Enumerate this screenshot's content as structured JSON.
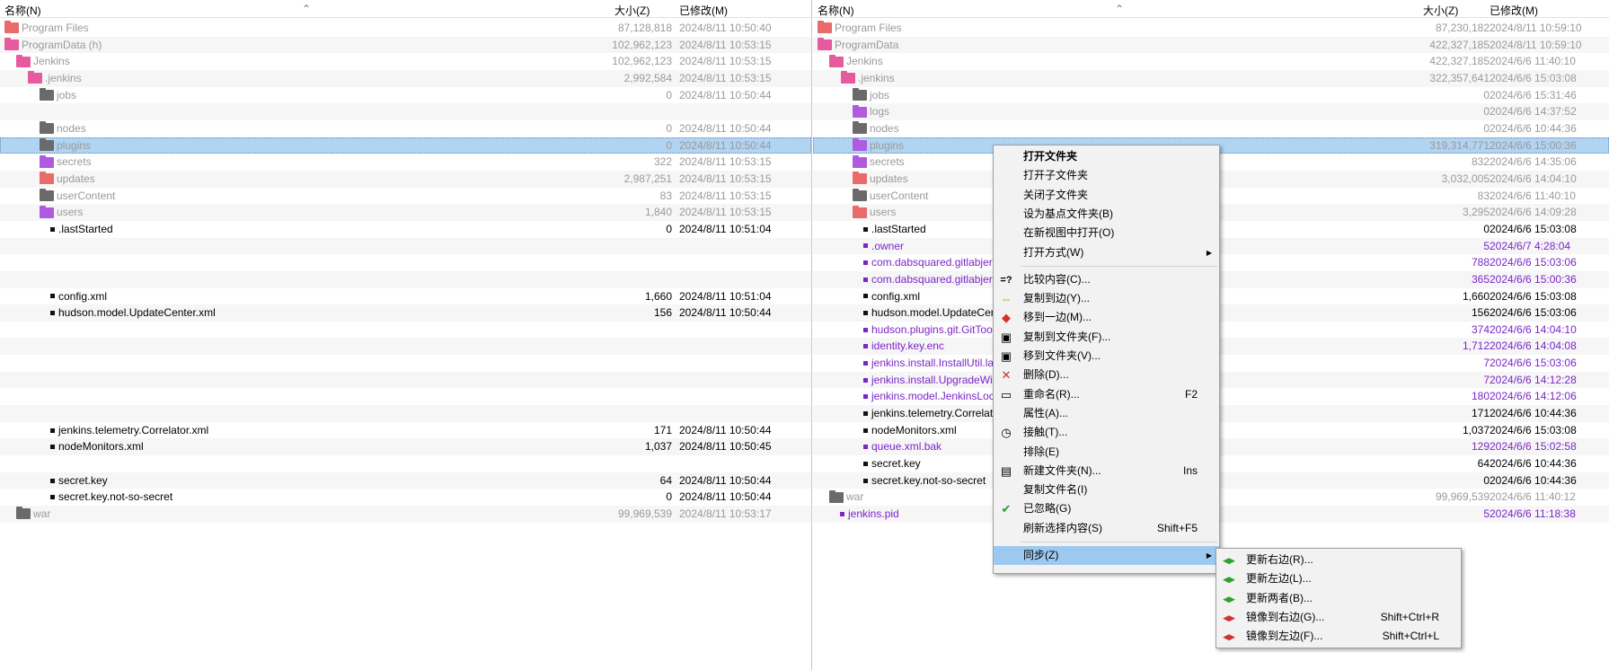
{
  "columns": {
    "name": "名称(N)",
    "size": "大小(Z)",
    "modified": "已修改(M)"
  },
  "left": {
    "rows": [
      {
        "name": "Program Files",
        "size": "87,128,818",
        "date": "2024/8/11 10:50:40",
        "type": "folder",
        "icon": "folder-red-icon",
        "tone": "gray"
      },
      {
        "name": "ProgramData (h)",
        "size": "102,962,123",
        "date": "2024/8/11 10:53:15",
        "type": "folder",
        "icon": "folder-pink-icon",
        "tone": "gray"
      },
      {
        "name": "Jenkins",
        "size": "102,962,123",
        "date": "2024/8/11 10:53:15",
        "type": "folder",
        "icon": "folder-pink-icon",
        "tone": "gray"
      },
      {
        "name": ".jenkins",
        "size": "2,992,584",
        "date": "2024/8/11 10:53:15",
        "type": "folder",
        "icon": "folder-pink-icon",
        "tone": "gray"
      },
      {
        "name": "jobs",
        "size": "0",
        "date": "2024/8/11 10:50:44",
        "type": "folder",
        "icon": "folder-dark-icon",
        "tone": "gray"
      },
      {
        "name": "",
        "size": "",
        "date": "",
        "type": "blank"
      },
      {
        "name": "nodes",
        "size": "0",
        "date": "2024/8/11 10:50:44",
        "type": "folder",
        "icon": "folder-dark-icon",
        "tone": "gray"
      },
      {
        "name": "plugins",
        "size": "0",
        "date": "2024/8/11 10:50:44",
        "type": "folder",
        "icon": "folder-dark-icon",
        "tone": "gray",
        "selected": true
      },
      {
        "name": "secrets",
        "size": "322",
        "date": "2024/8/11 10:53:15",
        "type": "folder",
        "icon": "folder-purple-icon",
        "tone": "gray"
      },
      {
        "name": "updates",
        "size": "2,987,251",
        "date": "2024/8/11 10:53:15",
        "type": "folder",
        "icon": "folder-red-icon",
        "tone": "gray"
      },
      {
        "name": "userContent",
        "size": "83",
        "date": "2024/8/11 10:53:15",
        "type": "folder",
        "icon": "folder-dark-icon",
        "tone": "gray"
      },
      {
        "name": "users",
        "size": "1,840",
        "date": "2024/8/11 10:53:15",
        "type": "folder",
        "icon": "folder-purple-icon",
        "tone": "gray"
      },
      {
        "name": ".lastStarted",
        "size": "0",
        "date": "2024/8/11 10:51:04",
        "type": "file",
        "tone": "black"
      },
      {
        "name": "",
        "size": "",
        "date": "",
        "type": "blank"
      },
      {
        "name": "",
        "size": "",
        "date": "",
        "type": "blank"
      },
      {
        "name": "",
        "size": "",
        "date": "",
        "type": "blank"
      },
      {
        "name": "config.xml",
        "size": "1,660",
        "date": "2024/8/11 10:51:04",
        "type": "file",
        "tone": "black"
      },
      {
        "name": "hudson.model.UpdateCenter.xml",
        "size": "156",
        "date": "2024/8/11 10:50:44",
        "type": "file",
        "tone": "black"
      },
      {
        "name": "",
        "size": "",
        "date": "",
        "type": "blank"
      },
      {
        "name": "",
        "size": "",
        "date": "",
        "type": "blank"
      },
      {
        "name": "",
        "size": "",
        "date": "",
        "type": "blank"
      },
      {
        "name": "",
        "size": "",
        "date": "",
        "type": "blank"
      },
      {
        "name": "",
        "size": "",
        "date": "",
        "type": "blank"
      },
      {
        "name": "",
        "size": "",
        "date": "",
        "type": "blank"
      },
      {
        "name": "jenkins.telemetry.Correlator.xml",
        "size": "171",
        "date": "2024/8/11 10:50:44",
        "type": "file",
        "tone": "black"
      },
      {
        "name": "nodeMonitors.xml",
        "size": "1,037",
        "date": "2024/8/11 10:50:45",
        "type": "file",
        "tone": "black"
      },
      {
        "name": "",
        "size": "",
        "date": "",
        "type": "blank"
      },
      {
        "name": "secret.key",
        "size": "64",
        "date": "2024/8/11 10:50:44",
        "type": "file",
        "tone": "black"
      },
      {
        "name": "secret.key.not-so-secret",
        "size": "0",
        "date": "2024/8/11 10:50:44",
        "type": "file",
        "tone": "black"
      },
      {
        "name": "war",
        "size": "99,969,539",
        "date": "2024/8/11 10:53:17",
        "type": "folder",
        "icon": "folder-dark-icon",
        "tone": "gray"
      }
    ]
  },
  "right": {
    "rows": [
      {
        "name": "Program Files",
        "size": "87,230,182",
        "date": "2024/8/11 10:59:10",
        "type": "folder",
        "icon": "folder-red-icon",
        "tone": "gray"
      },
      {
        "name": "ProgramData",
        "size": "422,327,185",
        "date": "2024/8/11 10:59:10",
        "type": "folder",
        "icon": "folder-pink-icon",
        "tone": "gray"
      },
      {
        "name": "Jenkins",
        "size": "422,327,185",
        "date": "2024/6/6 11:40:10",
        "type": "folder",
        "icon": "folder-pink-icon",
        "tone": "gray"
      },
      {
        "name": ".jenkins",
        "size": "322,357,641",
        "date": "2024/6/6 15:03:08",
        "type": "folder",
        "icon": "folder-pink-icon",
        "tone": "gray"
      },
      {
        "name": "jobs",
        "size": "0",
        "date": "2024/6/6 15:31:46",
        "type": "folder",
        "icon": "folder-dark-icon",
        "tone": "gray"
      },
      {
        "name": "logs",
        "size": "0",
        "date": "2024/6/6 14:37:52",
        "type": "folder",
        "icon": "folder-purple-icon",
        "tone": "gray"
      },
      {
        "name": "nodes",
        "size": "0",
        "date": "2024/6/6 10:44:36",
        "type": "folder",
        "icon": "folder-dark-icon",
        "tone": "gray"
      },
      {
        "name": "plugins",
        "size": "319,314,771",
        "date": "2024/6/6 15:00:36",
        "type": "folder",
        "icon": "folder-purple-icon",
        "tone": "gray",
        "selected": true
      },
      {
        "name": "secrets",
        "size": "832",
        "date": "2024/6/6 14:35:06",
        "type": "folder",
        "icon": "folder-purple-icon",
        "tone": "gray"
      },
      {
        "name": "updates",
        "size": "3,032,005",
        "date": "2024/6/6 14:04:10",
        "type": "folder",
        "icon": "folder-red-icon",
        "tone": "gray"
      },
      {
        "name": "userContent",
        "size": "83",
        "date": "2024/6/6 11:40:10",
        "type": "folder",
        "icon": "folder-dark-icon",
        "tone": "gray"
      },
      {
        "name": "users",
        "size": "3,295",
        "date": "2024/6/6 14:09:28",
        "type": "folder",
        "icon": "folder-red-icon",
        "tone": "gray"
      },
      {
        "name": ".lastStarted",
        "size": "0",
        "date": "2024/6/6 15:03:08",
        "type": "file",
        "tone": "black"
      },
      {
        "name": ".owner",
        "size": "5",
        "date": "2024/6/7 4:28:04",
        "type": "file",
        "tone": "purple"
      },
      {
        "name": "com.dabsquared.gitlabjer",
        "size": "788",
        "date": "2024/6/6 15:03:06",
        "type": "file",
        "tone": "purple"
      },
      {
        "name": "com.dabsquared.gitlabjer",
        "size": "365",
        "date": "2024/6/6 15:00:36",
        "type": "file",
        "tone": "purple"
      },
      {
        "name": "config.xml",
        "size": "1,660",
        "date": "2024/6/6 15:03:08",
        "type": "file",
        "tone": "black"
      },
      {
        "name": "hudson.model.UpdateCen",
        "size": "156",
        "date": "2024/6/6 15:03:06",
        "type": "file",
        "tone": "black"
      },
      {
        "name": "hudson.plugins.git.GitToo",
        "size": "374",
        "date": "2024/6/6 14:04:10",
        "type": "file",
        "tone": "purple"
      },
      {
        "name": "identity.key.enc",
        "size": "1,712",
        "date": "2024/6/6 14:04:08",
        "type": "file",
        "tone": "purple"
      },
      {
        "name": "jenkins.install.InstallUtil.las",
        "size": "7",
        "date": "2024/6/6 15:03:06",
        "type": "file",
        "tone": "purple"
      },
      {
        "name": "jenkins.install.UpgradeWiz",
        "size": "7",
        "date": "2024/6/6 14:12:28",
        "type": "file",
        "tone": "purple"
      },
      {
        "name": "jenkins.model.JenkinsLoca",
        "size": "180",
        "date": "2024/6/6 14:12:06",
        "type": "file",
        "tone": "purple"
      },
      {
        "name": "jenkins.telemetry.Correlato",
        "size": "171",
        "date": "2024/6/6 10:44:36",
        "type": "file",
        "tone": "black"
      },
      {
        "name": "nodeMonitors.xml",
        "size": "1,037",
        "date": "2024/6/6 15:03:08",
        "type": "file",
        "tone": "black"
      },
      {
        "name": "queue.xml.bak",
        "size": "129",
        "date": "2024/6/6 15:02:58",
        "type": "file",
        "tone": "purple"
      },
      {
        "name": "secret.key",
        "size": "64",
        "date": "2024/6/6 10:44:36",
        "type": "file",
        "tone": "black"
      },
      {
        "name": "secret.key.not-so-secret",
        "size": "0",
        "date": "2024/6/6 10:44:36",
        "type": "file",
        "tone": "black"
      },
      {
        "name": "war",
        "size": "99,969,539",
        "date": "2024/6/6 11:40:12",
        "type": "folder",
        "icon": "folder-dark-icon",
        "tone": "gray"
      },
      {
        "name": "jenkins.pid",
        "size": "5",
        "date": "2024/6/6 11:18:38",
        "type": "file",
        "tone": "purple"
      }
    ]
  },
  "context_menu": {
    "items": [
      {
        "label": "打开文件夹",
        "bold": true
      },
      {
        "label": "打开子文件夹"
      },
      {
        "label": "关闭子文件夹"
      },
      {
        "label": "设为基点文件夹(B)"
      },
      {
        "label": "在新视图中打开(O)"
      },
      {
        "label": "打开方式(W)",
        "submenu": true
      },
      {
        "sep": true
      },
      {
        "label": "比较内容(C)...",
        "icon": "compare-icon",
        "glyph": "=?"
      },
      {
        "label": "复制到边(Y)...",
        "icon": "copy-to-side-icon",
        "glyph": "⇔"
      },
      {
        "label": "移到一边(M)...",
        "icon": "move-to-side-icon",
        "glyph": "◆"
      },
      {
        "label": "复制到文件夹(F)...",
        "icon": "copy-to-folder-icon",
        "glyph": "▣"
      },
      {
        "label": "移到文件夹(V)...",
        "icon": "move-to-folder-icon",
        "glyph": "▣"
      },
      {
        "label": "删除(D)...",
        "icon": "delete-icon",
        "glyph": "✕"
      },
      {
        "label": "重命名(R)...",
        "shortcut": "F2",
        "icon": "rename-icon",
        "glyph": "▭"
      },
      {
        "label": "属性(A)..."
      },
      {
        "label": "接触(T)...",
        "icon": "touch-icon",
        "glyph": "◷"
      },
      {
        "label": "排除(E)"
      },
      {
        "label": "新建文件夹(N)...",
        "shortcut": "Ins",
        "icon": "new-folder-icon",
        "glyph": "▤"
      },
      {
        "label": "复制文件名(I)"
      },
      {
        "label": "已忽略(G)",
        "icon": "check-icon",
        "glyph": "✔"
      },
      {
        "label": "刷新选择内容(S)",
        "shortcut": "Shift+F5"
      },
      {
        "sep": true
      },
      {
        "label": "同步(Z)",
        "submenu": true,
        "highlighted": true
      }
    ]
  },
  "sync_submenu": {
    "items": [
      {
        "label": "更新右边(R)...",
        "icon": "update-right-icon"
      },
      {
        "label": "更新左边(L)...",
        "icon": "update-left-icon"
      },
      {
        "label": "更新两者(B)...",
        "icon": "update-both-icon"
      },
      {
        "label": "镜像到右边(G)...",
        "shortcut": "Shift+Ctrl+R",
        "icon": "mirror-right-icon"
      },
      {
        "label": "镜像到左边(F)...",
        "shortcut": "Shift+Ctrl+L",
        "icon": "mirror-left-icon"
      }
    ]
  },
  "colors": {
    "selection": "#b0d4f1",
    "menu_highlight": "#9dc9f1",
    "purple_text": "#7b25c8",
    "gray_text": "#9a9a9a"
  }
}
